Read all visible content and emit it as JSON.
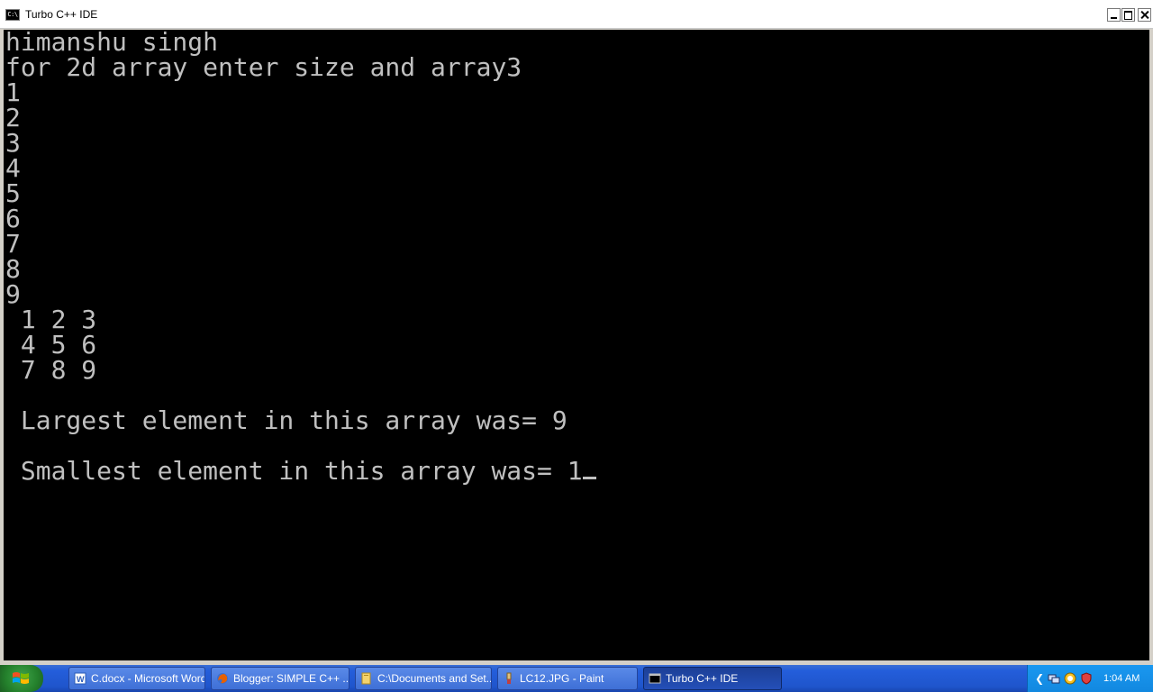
{
  "window": {
    "title": "Turbo C++ IDE",
    "icon_text": "C:\\"
  },
  "console": {
    "lines": [
      "himanshu singh",
      "for 2d array enter size and array3",
      "1",
      "2",
      "3",
      "4",
      "5",
      "6",
      "7",
      "8",
      "9",
      " 1 2 3",
      " 4 5 6",
      " 7 8 9",
      "",
      " Largest element in this array was= 9",
      "",
      " Smallest element in this array was= 1"
    ],
    "text_color": "#c0c0c0",
    "background": "#000000"
  },
  "taskbar": {
    "tasks": [
      {
        "label": "C.docx - Microsoft Word",
        "icon": "word-icon"
      },
      {
        "label": "Blogger: SIMPLE C++ ...",
        "icon": "firefox-icon"
      },
      {
        "label": "C:\\Documents and Set...",
        "icon": "folder-icon"
      },
      {
        "label": "LC12.JPG - Paint",
        "icon": "paint-icon"
      },
      {
        "label": "Turbo C++ IDE",
        "icon": "console-icon",
        "active": true
      }
    ],
    "clock": "1:04 AM",
    "tray_icons": [
      "network-icon",
      "norton-icon",
      "shield-icon"
    ]
  }
}
